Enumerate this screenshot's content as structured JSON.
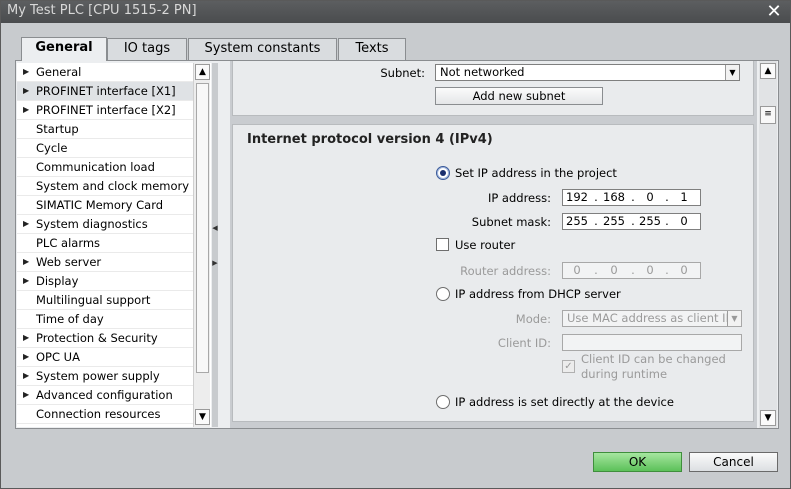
{
  "window": {
    "title": "My Test PLC [CPU 1515-2 PN]"
  },
  "tabs": [
    {
      "label": "General",
      "active": true
    },
    {
      "label": "IO tags",
      "active": false
    },
    {
      "label": "System constants",
      "active": false
    },
    {
      "label": "Texts",
      "active": false
    }
  ],
  "nav": {
    "items": [
      {
        "label": "General",
        "expandable": true
      },
      {
        "label": "PROFINET interface [X1]",
        "expandable": true,
        "selected": true
      },
      {
        "label": "PROFINET interface [X2]",
        "expandable": true
      },
      {
        "label": "Startup",
        "expandable": false
      },
      {
        "label": "Cycle",
        "expandable": false
      },
      {
        "label": "Communication load",
        "expandable": false
      },
      {
        "label": "System and clock memory",
        "expandable": false
      },
      {
        "label": "SIMATIC Memory Card",
        "expandable": false
      },
      {
        "label": "System diagnostics",
        "expandable": true
      },
      {
        "label": "PLC alarms",
        "expandable": false
      },
      {
        "label": "Web server",
        "expandable": true
      },
      {
        "label": "Display",
        "expandable": true
      },
      {
        "label": "Multilingual support",
        "expandable": false
      },
      {
        "label": "Time of day",
        "expandable": false
      },
      {
        "label": "Protection & Security",
        "expandable": true
      },
      {
        "label": "OPC UA",
        "expandable": true
      },
      {
        "label": "System power supply",
        "expandable": true
      },
      {
        "label": "Advanced configuration",
        "expandable": true
      },
      {
        "label": "Connection resources",
        "expandable": false
      }
    ]
  },
  "subnet": {
    "label": "Subnet:",
    "value": "Not networked",
    "add_button": "Add new subnet"
  },
  "ipv4": {
    "title": "Internet protocol version 4 (IPv4)",
    "set_in_project": "Set IP address in the project",
    "ip_label": "IP address:",
    "ip": [
      "192",
      "168",
      "0",
      "1"
    ],
    "mask_label": "Subnet mask:",
    "mask": [
      "255",
      "255",
      "255",
      "0"
    ],
    "use_router": "Use router",
    "router_label": "Router address:",
    "router": [
      "0",
      "0",
      "0",
      "0"
    ],
    "dhcp": "IP address from DHCP server",
    "mode_label": "Mode:",
    "mode_value": "Use MAC address as client ID",
    "client_id_label": "Client ID:",
    "client_id_value": "",
    "client_change_line1": "Client ID can be changed",
    "client_change_line2": "during runtime",
    "set_at_device": "IP address is set directly at the device"
  },
  "footer": {
    "ok": "OK",
    "cancel": "Cancel"
  },
  "colors": {
    "ok_button": "#5cc159",
    "title_bar": "#4a4c4e",
    "radio_selected": "#1a2f6e"
  }
}
